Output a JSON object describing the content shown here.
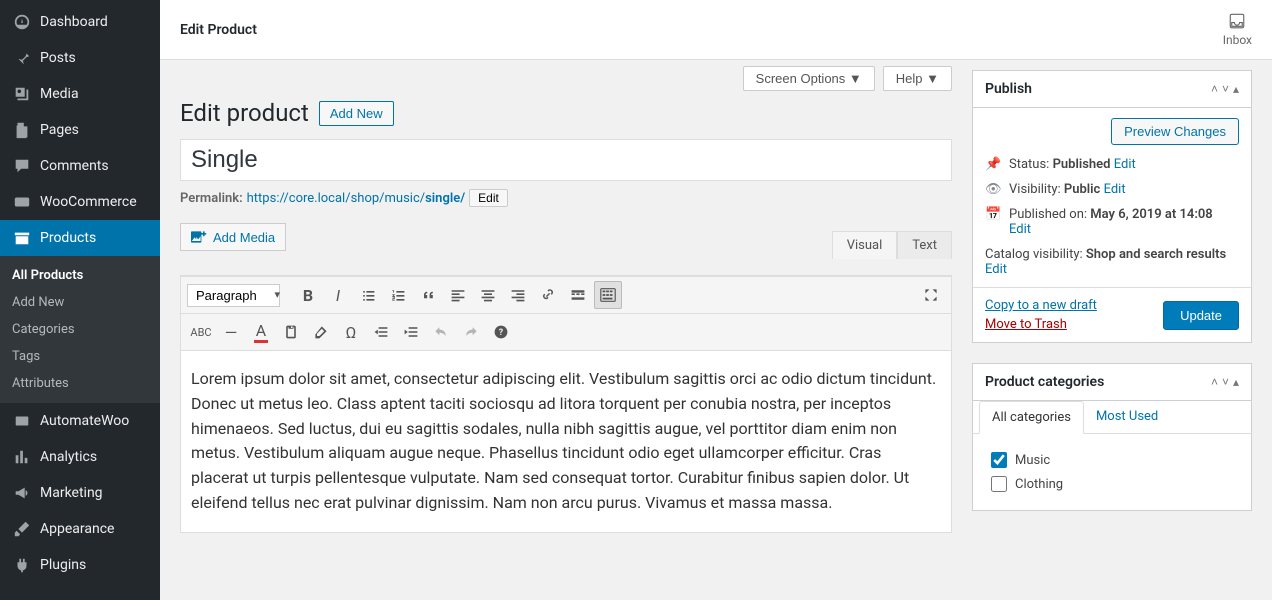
{
  "topbar": {
    "title": "Edit Product",
    "inbox_label": "Inbox"
  },
  "sidebar": {
    "items": [
      {
        "id": "dashboard",
        "label": "Dashboard",
        "icon": "dashboard"
      },
      {
        "id": "posts",
        "label": "Posts",
        "icon": "pin"
      },
      {
        "id": "media",
        "label": "Media",
        "icon": "media"
      },
      {
        "id": "pages",
        "label": "Pages",
        "icon": "pages"
      },
      {
        "id": "comments",
        "label": "Comments",
        "icon": "comment"
      },
      {
        "id": "woocommerce",
        "label": "WooCommerce",
        "icon": "woo"
      },
      {
        "id": "products",
        "label": "Products",
        "icon": "archive",
        "active": true
      },
      {
        "id": "automatewoo",
        "label": "AutomateWoo",
        "icon": "aw"
      },
      {
        "id": "analytics",
        "label": "Analytics",
        "icon": "chart"
      },
      {
        "id": "marketing",
        "label": "Marketing",
        "icon": "megaphone"
      },
      {
        "id": "appearance",
        "label": "Appearance",
        "icon": "brush"
      },
      {
        "id": "plugins",
        "label": "Plugins",
        "icon": "plugin"
      }
    ],
    "submenu": [
      {
        "label": "All Products",
        "current": true
      },
      {
        "label": "Add New"
      },
      {
        "label": "Categories"
      },
      {
        "label": "Tags"
      },
      {
        "label": "Attributes"
      }
    ]
  },
  "screen": {
    "options_label": "Screen Options",
    "help_label": "Help"
  },
  "heading": {
    "text": "Edit product",
    "add_new": "Add New"
  },
  "title_value": "Single",
  "permalink": {
    "label": "Permalink:",
    "base": "https://core.local/shop/music/",
    "slug": "single",
    "edit": "Edit"
  },
  "editor": {
    "add_media": "Add Media",
    "tab_visual": "Visual",
    "tab_text": "Text",
    "format_select": "Paragraph",
    "content": "Lorem ipsum dolor sit amet, consectetur adipiscing elit. Vestibulum sagittis orci ac odio dictum tincidunt. Donec ut metus leo. Class aptent taciti sociosqu ad litora torquent per conubia nostra, per inceptos himenaeos. Sed luctus, dui eu sagittis sodales, nulla nibh sagittis augue, vel porttitor diam enim non metus. Vestibulum aliquam augue neque. Phasellus tincidunt odio eget ullamcorper efficitur. Cras placerat ut turpis pellentesque vulputate. Nam sed consequat tortor. Curabitur finibus sapien dolor. Ut eleifend tellus nec erat pulvinar dignissim. Nam non arcu purus. Vivamus et massa massa."
  },
  "publish": {
    "title": "Publish",
    "preview": "Preview Changes",
    "status_label": "Status:",
    "status_value": "Published",
    "visibility_label": "Visibility:",
    "visibility_value": "Public",
    "published_label": "Published on:",
    "published_value": "May 6, 2019 at 14:08",
    "edit": "Edit",
    "catalog_label": "Catalog visibility:",
    "catalog_value": "Shop and search results",
    "copy_draft": "Copy to a new draft",
    "trash": "Move to Trash",
    "update": "Update"
  },
  "categories": {
    "title": "Product categories",
    "tab_all": "All categories",
    "tab_most": "Most Used",
    "items": [
      {
        "label": "Music",
        "checked": true
      },
      {
        "label": "Clothing",
        "checked": false
      }
    ]
  }
}
